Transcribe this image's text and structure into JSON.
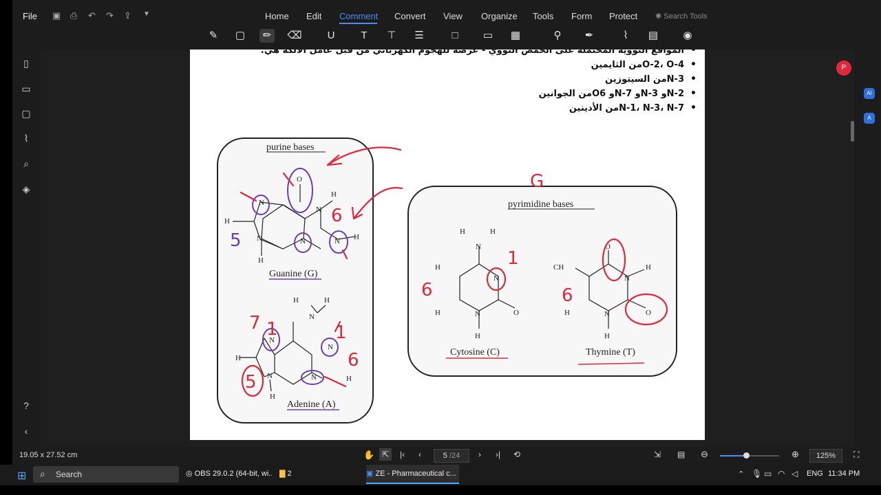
{
  "menu": {
    "file": "File",
    "items": [
      "Home",
      "Edit",
      "Comment",
      "Convert",
      "View",
      "Organize",
      "Tools",
      "Form",
      "Protect"
    ],
    "active": "Comment",
    "search_tools": "Search Tools"
  },
  "document": {
    "lines": [
      {
        "bullet": "•",
        "text": "المواقع النووية المحتملة على الحمض النووي - عرضة للهجوم الكهربائي من قبل عامل الألكة هي:"
      },
      {
        "bullet": "•",
        "text": "O-2، O-4من الثايمين"
      },
      {
        "bullet": "•",
        "text": "N-3من السيتوزين"
      },
      {
        "bullet": "•",
        "text": "N-2و N-3و N-7و O6من الجوانين"
      },
      {
        "bullet": "•",
        "text": "N-1، N-3، N-7من الأدينين"
      }
    ],
    "purine": {
      "title": "purine bases",
      "guanine": "Guanine (G)",
      "adenine": "Adenine (A)"
    },
    "pyrimidine": {
      "title": "pyrimidine bases",
      "cytosine": "Cytosine (C)",
      "thymine": "Thymine (T)"
    },
    "annotations": [
      "6",
      "5",
      "6",
      "7",
      "1",
      "1",
      "5",
      "6",
      "6",
      "6",
      "1",
      "G"
    ]
  },
  "status": {
    "dimensions": "19.05 x 27.52 cm",
    "page": "5",
    "page_total": "/24",
    "zoom": "125%"
  },
  "taskbar": {
    "search": "Search",
    "apps": [
      "OBS 29.0.2 (64-bit, wi...",
      "2",
      "ZE - Pharmaceutical c..."
    ],
    "lang": "ENG",
    "time": "11:34 PM"
  },
  "colors": {
    "accent": "#4e8df5",
    "pen_red": "#e0283c",
    "pen_purple": "#6a3fb5"
  }
}
